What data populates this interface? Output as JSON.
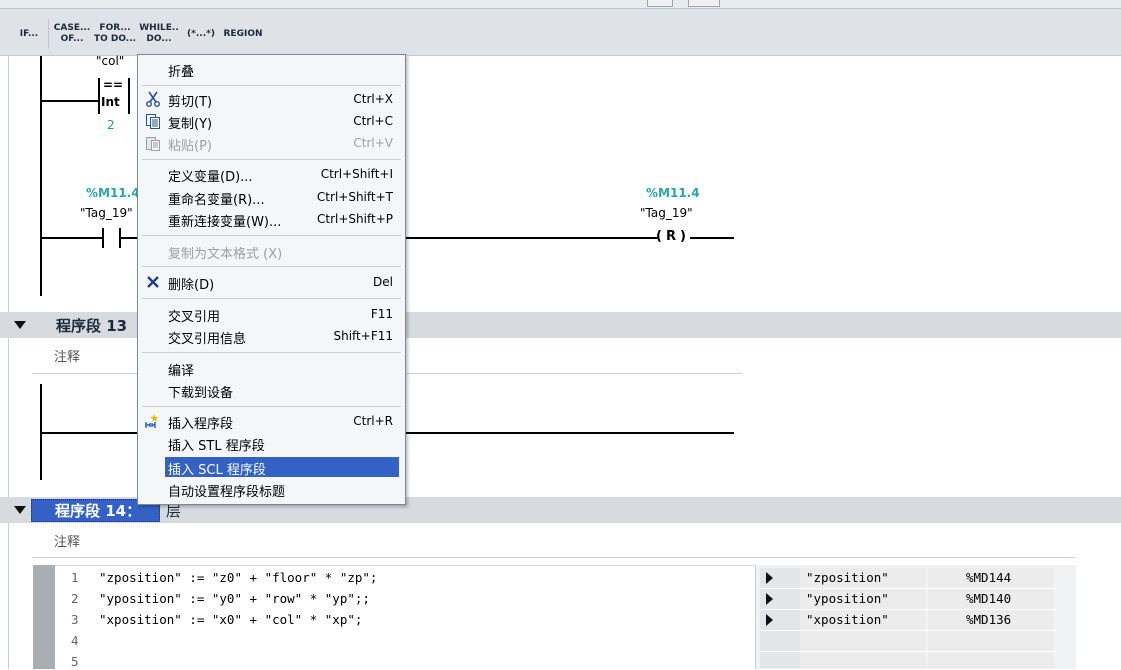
{
  "toolbar": {
    "buttons": [
      {
        "name": "if-button",
        "label": "IF..."
      },
      {
        "name": "case-button",
        "label": "CASE...\nOF..."
      },
      {
        "name": "for-button",
        "label": "FOR...\nTO DO..."
      },
      {
        "name": "while-button",
        "label": "WHILE..\nDO..."
      },
      {
        "name": "comment-button",
        "label": "(*...*)"
      },
      {
        "name": "region-button",
        "label": "REGION"
      }
    ]
  },
  "network_top": {
    "compare_operand": "\"col\"",
    "compare_op": "==",
    "compare_type": "Int",
    "compare_value": "2",
    "contact_address": "%M11.4",
    "contact_tag": "\"Tag_19\"",
    "coil_address": "%M11.4",
    "coil_tag": "\"Tag_19\"",
    "coil_symbol": "R"
  },
  "network13": {
    "title": "程序段 13",
    "comment": "注释"
  },
  "network14": {
    "title": "程序段 14：",
    "title_suffix": "层",
    "comment": "注释",
    "code_lines": [
      {
        "no": "1",
        "text": "\"zposition\" := \"z0\" + \"floor\" * \"zp\";"
      },
      {
        "no": "2",
        "text": "\"yposition\" := \"y0\" + \"row\" * \"yp\";;"
      },
      {
        "no": "3",
        "text": "\"xposition\" := \"x0\" + \"col\" * \"xp\";"
      },
      {
        "no": "4",
        "text": ""
      },
      {
        "no": "5",
        "text": ""
      }
    ],
    "var_table": [
      {
        "name": "\"zposition\"",
        "addr": "%MD144"
      },
      {
        "name": "\"yposition\"",
        "addr": "%MD140"
      },
      {
        "name": "\"xposition\"",
        "addr": "%MD136"
      }
    ]
  },
  "context_menu": {
    "collapse": "折叠",
    "cut": {
      "label": "剪切(T)",
      "shortcut": "Ctrl+X"
    },
    "copy": {
      "label": "复制(Y)",
      "shortcut": "Ctrl+C"
    },
    "paste": {
      "label": "粘贴(P)",
      "shortcut": "Ctrl+V"
    },
    "define_var": {
      "label": "定义变量(D)...",
      "shortcut": "Ctrl+Shift+I"
    },
    "rename_var": {
      "label": "重命名变量(R)...",
      "shortcut": "Ctrl+Shift+T"
    },
    "rewire_var": {
      "label": "重新连接变量(W)...",
      "shortcut": "Ctrl+Shift+P"
    },
    "copy_as_text": {
      "label": "复制为文本格式 (X)"
    },
    "delete": {
      "label": "删除(D)",
      "shortcut": "Del"
    },
    "cross_ref": {
      "label": "交叉引用",
      "shortcut": "F11"
    },
    "cross_ref_info": {
      "label": "交叉引用信息",
      "shortcut": "Shift+F11"
    },
    "compile": {
      "label": "编译"
    },
    "download": {
      "label": "下载到设备"
    },
    "insert_network": {
      "label": "插入程序段",
      "shortcut": "Ctrl+R"
    },
    "insert_stl": {
      "label": "插入 STL 程序段"
    },
    "insert_scl": {
      "label": "插入 SCL 程序段"
    },
    "auto_title": {
      "label": "自动设置程序段标题"
    }
  },
  "colors": {
    "address": "#2aa5a5",
    "highlight": "#3362c4",
    "network_bar": "#d7dbdf"
  }
}
